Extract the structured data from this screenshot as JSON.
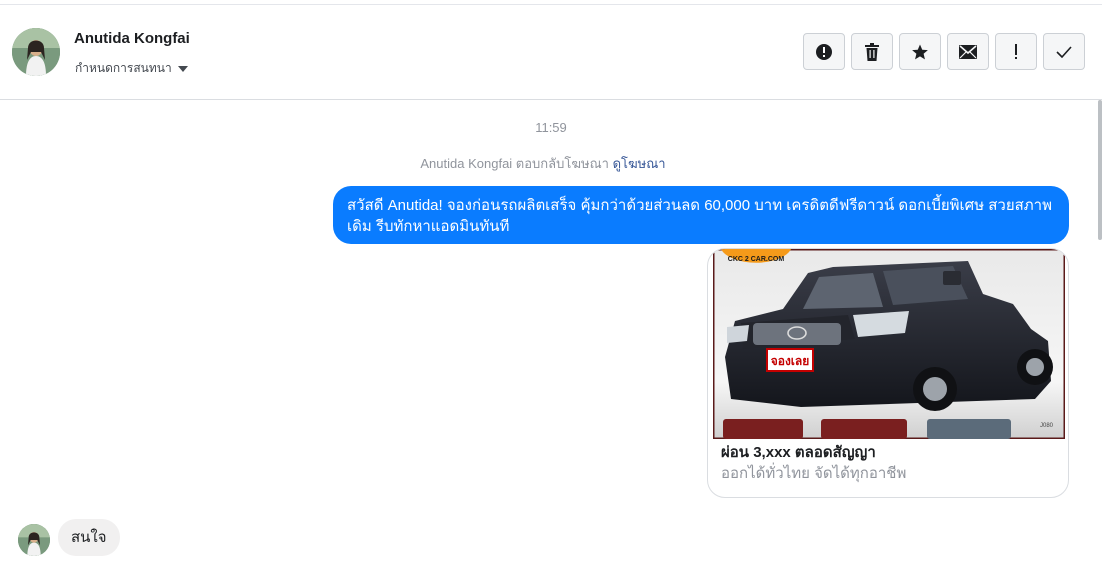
{
  "header": {
    "contact_name": "Anutida Kongfai",
    "settings_label": "กำหนดการสนทนา",
    "actions": [
      {
        "name": "report-button",
        "icon": "alert-circle-icon"
      },
      {
        "name": "delete-button",
        "icon": "trash-icon"
      },
      {
        "name": "star-button",
        "icon": "star-icon"
      },
      {
        "name": "mark-unread-button",
        "icon": "envelope-icon"
      },
      {
        "name": "follow-up-button",
        "icon": "exclamation-icon"
      },
      {
        "name": "mark-done-button",
        "icon": "checkmark-icon"
      }
    ]
  },
  "thread": {
    "timestamp": "11:59",
    "ad_reply_text": "Anutida Kongfai ตอบกลับโฆษณา",
    "view_ad_link": "ดูโฆษณา",
    "outgoing_message": "สวัสดี Anutida! จองก่อนรถผลิตเสร็จ คุ้มกว่าด้วยส่วนลด 60,000 บาท เครดิตดีฟรีดาวน์ ดอกเบี้ยพิเศษ สวยสภาพเดิม รีบทักหาแอดมินทันที",
    "ad_card": {
      "title": "ผ่อน 3,xxx ตลอดสัญญา",
      "subtitle": "ออกได้ทั่วไทย จัดได้ทุกอาชีพ",
      "image_logo_text": "CKC 2 CAR.COM",
      "image_badge_text": "จองเลย",
      "image_corner_text": "J080"
    },
    "incoming_message": "สนใจ"
  },
  "colors": {
    "outgoing_bubble": "#0a7cff",
    "incoming_bubble": "#f1f0f0",
    "link": "#385898",
    "meta_text": "#90949c"
  }
}
